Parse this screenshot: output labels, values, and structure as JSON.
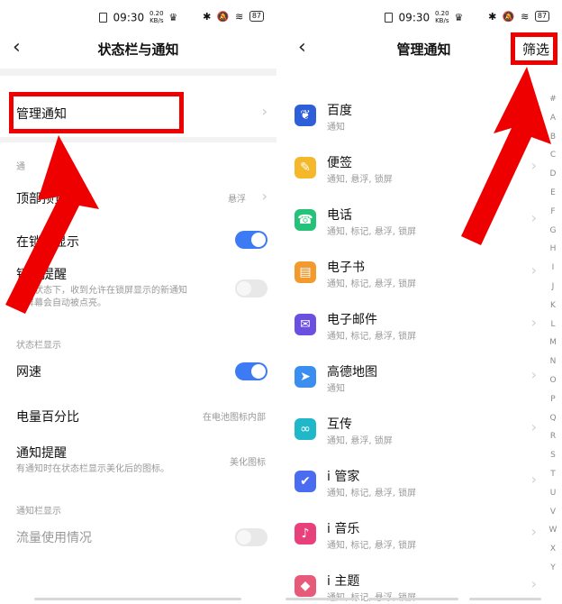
{
  "status_bar": {
    "time": "09:30",
    "speed_value": "0.20",
    "speed_unit": "KB/s",
    "crown_icon": "crown-icon",
    "battery": "87"
  },
  "left": {
    "title": "状态栏与通知",
    "manage_notifications": "管理通知",
    "section_notifications": "通",
    "top_preview_label": "顶部预览样式",
    "top_preview_value": "悬浮",
    "lockscreen_show_label": "在锁屏显示",
    "lockscreen_remind_label": "锁屏提醒",
    "lockscreen_remind_desc_1": "锁屏状态下，收到允许在锁屏显示的新通知",
    "lockscreen_remind_desc_2": "时屏幕会自动被点亮。",
    "section_statusbar": "状态栏显示",
    "network_speed_label": "网速",
    "battery_percent_label": "电量百分比",
    "battery_percent_value": "在电池图标内部",
    "notif_reminder_label": "通知提醒",
    "notif_reminder_desc": "有通知时在状态栏显示美化后的图标。",
    "notif_reminder_value": "美化图标",
    "section_notif_display": "通知栏显示",
    "data_usage_label": "流量使用情况"
  },
  "right": {
    "title": "管理通知",
    "filter": "筛选",
    "apps": [
      {
        "name": "百度",
        "desc": "通知",
        "icon": "baidu-icon",
        "color": "#2f5fd8"
      },
      {
        "name": "便签",
        "desc": "通知, 悬浮, 锁屏",
        "icon": "notes-icon",
        "color": "#f5b82a"
      },
      {
        "name": "电话",
        "desc": "通知, 标记, 悬浮, 锁屏",
        "icon": "phone-icon",
        "color": "#27c27a"
      },
      {
        "name": "电子书",
        "desc": "通知, 标记, 悬浮, 锁屏",
        "icon": "ebook-icon",
        "color": "#f29a2e"
      },
      {
        "name": "电子邮件",
        "desc": "通知, 标记, 悬浮, 锁屏",
        "icon": "email-icon",
        "color": "#6a4fe0"
      },
      {
        "name": "高德地图",
        "desc": "通知",
        "icon": "amap-icon",
        "color": "#3a8ef0"
      },
      {
        "name": "互传",
        "desc": "通知, 悬浮, 锁屏",
        "icon": "share-icon",
        "color": "#20b8c8"
      },
      {
        "name": "i 管家",
        "desc": "通知, 标记, 悬浮, 锁屏",
        "icon": "manager-icon",
        "color": "#4a6cf0"
      },
      {
        "name": "i 音乐",
        "desc": "通知, 标记, 悬浮, 锁屏",
        "icon": "music-icon",
        "color": "#e8407a"
      },
      {
        "name": "i 主题",
        "desc": "通知, 标记, 悬浮, 锁屏",
        "icon": "theme-icon",
        "color": "#e85a7a"
      }
    ],
    "alpha_index": [
      "#",
      "A",
      "B",
      "C",
      "D",
      "E",
      "F",
      "G",
      "H",
      "I",
      "J",
      "K",
      "L",
      "M",
      "N",
      "O",
      "P",
      "Q",
      "R",
      "S",
      "T",
      "U",
      "V",
      "W",
      "X",
      "Y"
    ]
  },
  "colors": {
    "toggle_on": "#3d7bf5",
    "annotation_red": "#ee0000"
  }
}
